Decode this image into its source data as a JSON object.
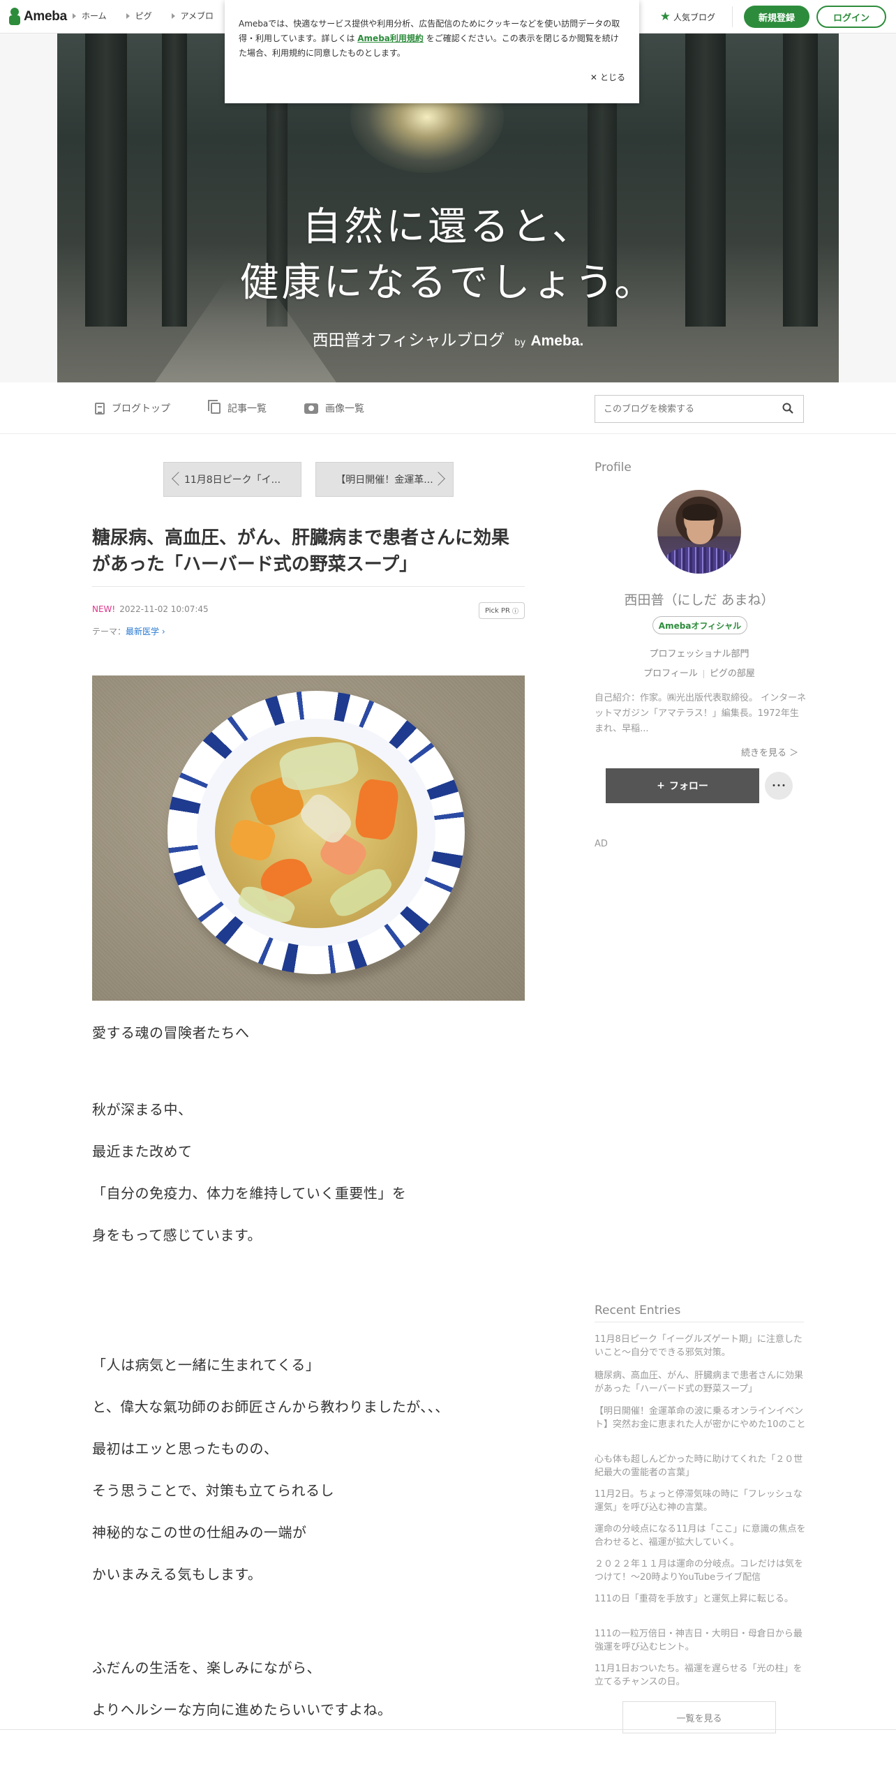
{
  "global_header": {
    "logo": "Ameba",
    "nav": [
      "ホーム",
      "ピグ",
      "アメブロ"
    ],
    "popular_blog": "人気ブログ",
    "signup": "新規登録",
    "login": "ログイン"
  },
  "cookie_banner": {
    "text_before": "Amebaでは、快適なサービス提供や利用分析、広告配信のためにクッキーなどを使い訪問データの取得・利用しています。詳しくは ",
    "link": "Ameba利用規約",
    "text_after": " をご確認ください。この表示を閉じるか閲覧を続けた場合、利用規約に同意したものとします。",
    "close": "とじる"
  },
  "hero": {
    "line1": "自然に還ると、",
    "line2": "健康になるでしょう。",
    "blog_name": "西田普オフィシャルブログ",
    "by": "by",
    "ameba": "Ameba."
  },
  "blog_nav": {
    "top": "ブログトップ",
    "entries": "記事一覧",
    "images": "画像一覧",
    "search_placeholder": "このブログを検索する"
  },
  "article": {
    "prev": "11月8日ピーク「イ...",
    "next": "【明日開催！金運革...",
    "title": "糖尿病、高血圧、がん、肝臓病まで患者さんに効果があった「ハーバード式の野菜スープ」",
    "new_label": "NEW!",
    "datetime": "2022-11-02 10:07:45",
    "pick_pr": "Pick PR",
    "theme_label": "テーマ：",
    "theme": "最新医学",
    "paragraphs": [
      "愛する魂の冒険者たちへ",
      "秋が深まる中、",
      "最近また改めて",
      "「自分の免疫力、体力を維持していく重要性」を",
      "身をもって感じています。",
      "「人は病気と一緒に生まれてくる」",
      "と、偉大な氣功師のお師匠さんから教わりましたが、、、",
      "最初はエッと思ったものの、",
      "そう思うことで、対策も立てられるし",
      "神秘的なこの世の仕組みの一端が",
      "かいまみえる気もします。",
      "ふだんの生活を、楽しみにながら、",
      "よりヘルシーな方向に進めたらいいですよね。"
    ]
  },
  "sidebar": {
    "profile_heading": "Profile",
    "name": "西田普（にしだ あまね）",
    "badge": "Amebaオフィシャル",
    "category": "プロフェッショナル部門",
    "profile_link": "プロフィール",
    "pig_link": "ピグの部屋",
    "intro": "自己紹介：作家。㈱光出版代表取締役。 インターネットマガジン「アマテラス！」編集長。1972年生まれ、早稲...",
    "read_more": "続きを見る ＞",
    "follow": "フォロー",
    "more": "･･･",
    "ad": "AD",
    "recent_heading": "Recent Entries",
    "recent": [
      "11月8日ピーク「イーグルズゲート期」に注意したいこと〜自分でできる邪気対策。",
      "糖尿病、高血圧、がん、肝臓病まで患者さんに効果があった「ハーバード式の野菜スープ」",
      "【明日開催！金運革命の波に乗るオンラインイベント】突然お金に恵まれた人が密かにやめた10のこと",
      "心も体も超しんどかった時に助けてくれた「２０世紀最大の霊能者の言葉」",
      "11月2日。ちょっと停滞気味の時に「フレッシュな運気」を呼び込む神の言葉。",
      "運命の分岐点になる11月は「ここ」に意識の焦点を合わせると、福運が拡大していく。",
      "２０２２年１１月は運命の分岐点。コレだけは気をつけて！〜20時よりYouTubeライブ配信",
      "111の日「重荷を手放す」と運気上昇に転じる。",
      "111の一粒万倍日・神吉日・大明日・母倉日から最強運を呼び込むヒント。",
      "11月1日おついたち。福運を遅らせる「光の柱」を立てるチャンスの日。"
    ],
    "see_all": "一覧を見る"
  },
  "colors": {
    "brand_green": "#2d8c3c",
    "new_pink": "#e0338b",
    "link_blue": "#2a7bd3",
    "follow_button": "#555555"
  }
}
